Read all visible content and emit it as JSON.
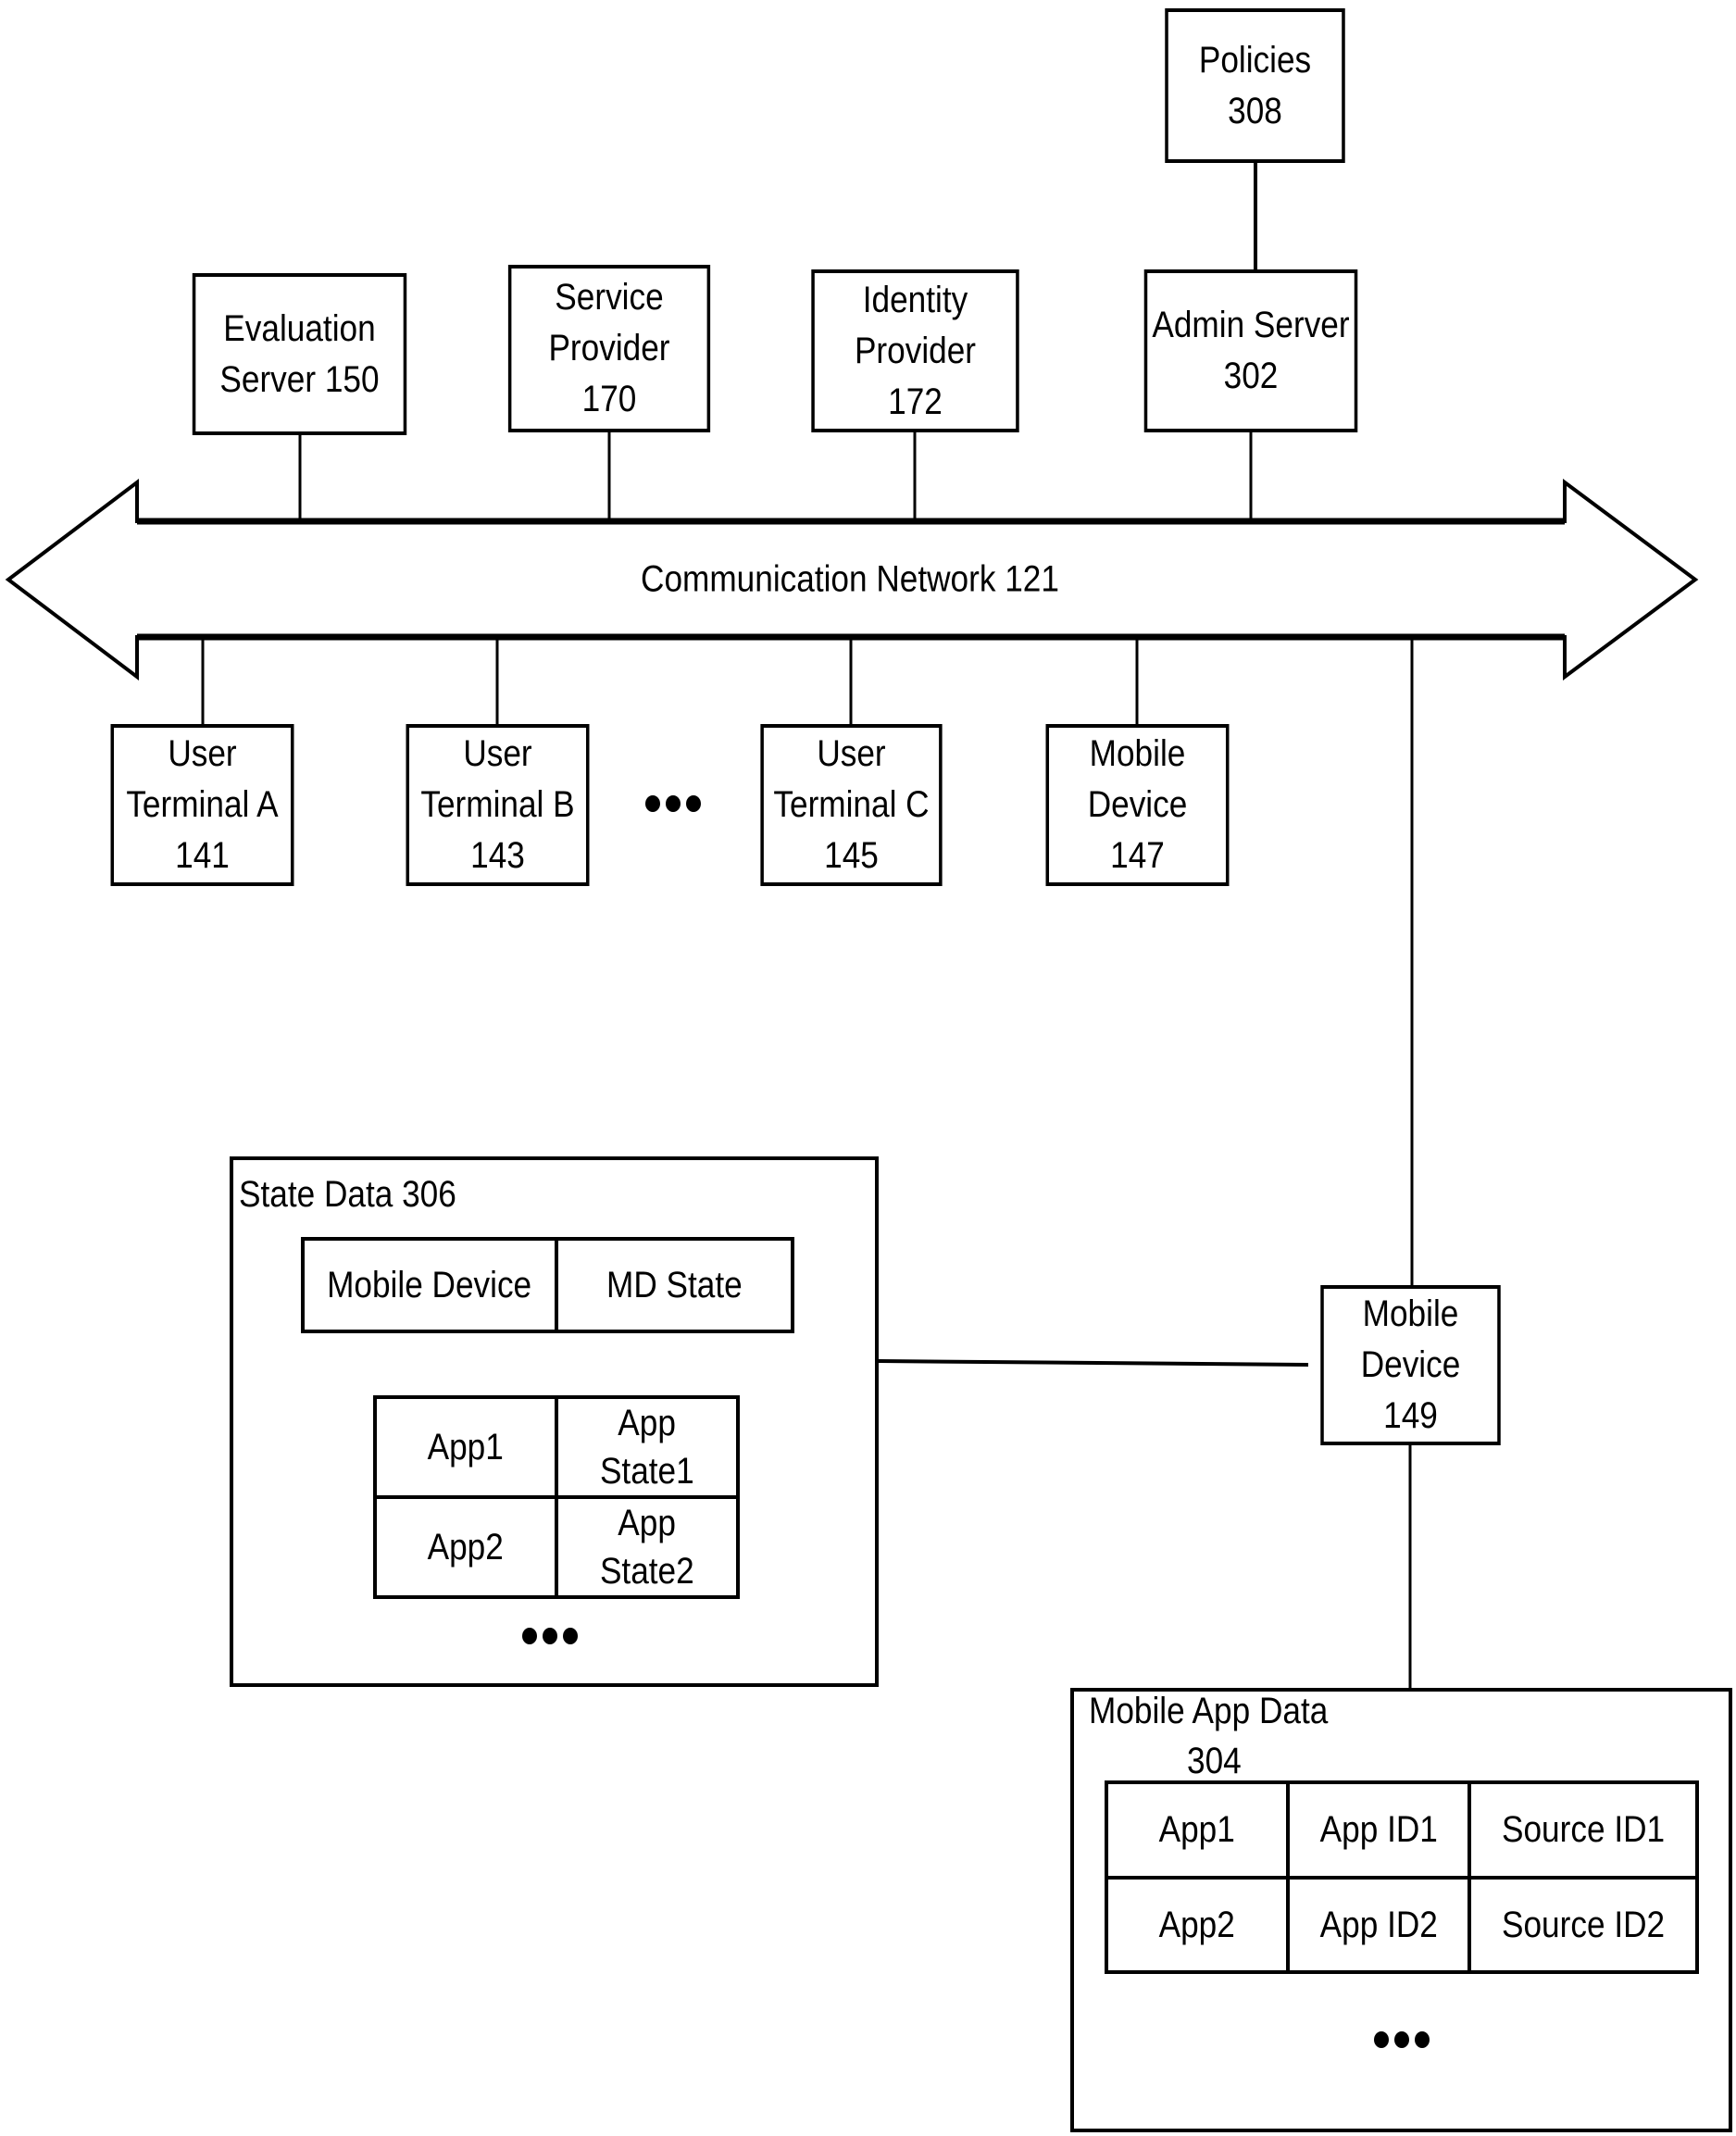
{
  "diagram": {
    "nodes": {
      "policies": {
        "line1": "Policies",
        "line2": "308"
      },
      "admin_server": {
        "line1": "Admin Server",
        "line2": "302"
      },
      "evaluation_server": {
        "line1": "Evaluation",
        "line2": "Server 150"
      },
      "service_provider": {
        "line1": "Service",
        "line2": "Provider",
        "line3": "170"
      },
      "identity_provider": {
        "line1": "Identity",
        "line2": "Provider",
        "line3": "172"
      },
      "user_terminal_a": {
        "line1": "User",
        "line2": "Terminal A",
        "line3": "141"
      },
      "user_terminal_b": {
        "line1": "User",
        "line2": "Terminal B",
        "line3": "143"
      },
      "user_terminal_c": {
        "line1": "User",
        "line2": "Terminal C",
        "line3": "145"
      },
      "mobile_device_147": {
        "line1": "Mobile",
        "line2": "Device",
        "line3": "147"
      },
      "mobile_device_149": {
        "line1": "Mobile",
        "line2": "Device",
        "line3": "149"
      }
    },
    "network": {
      "label": "Communication Network  121"
    },
    "ellipsis": "•••",
    "state_data": {
      "title": "State Data 306",
      "device_row": [
        "Mobile Device",
        "MD State"
      ],
      "app_rows": [
        {
          "app": "App1",
          "state_line1": "App",
          "state_line2": "State1"
        },
        {
          "app": "App2",
          "state_line1": "App",
          "state_line2": "State2"
        }
      ]
    },
    "mobile_app_data": {
      "title_line1": "Mobile App Data",
      "title_line2": "304",
      "rows": [
        [
          "App1",
          "App ID1",
          "Source ID1"
        ],
        [
          "App2",
          "App ID2",
          "Source ID2"
        ]
      ]
    }
  }
}
